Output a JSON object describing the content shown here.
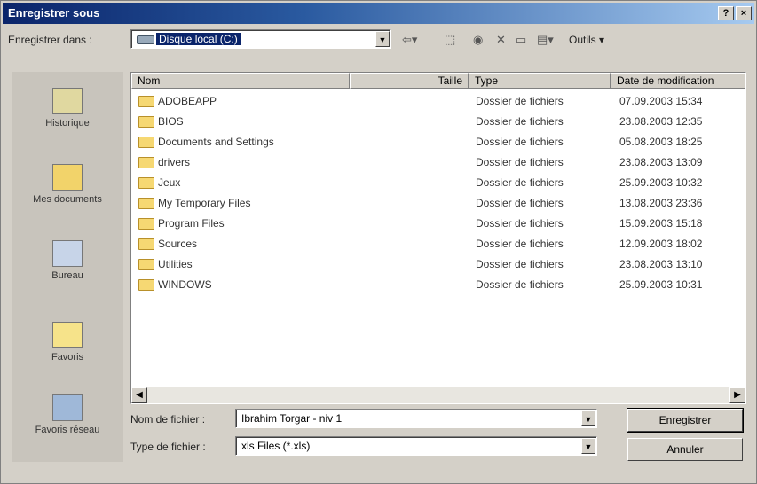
{
  "title": "Enregistrer sous",
  "title_buttons": [
    "?",
    "×"
  ],
  "save_in": {
    "label": "Enregistrer dans :",
    "value": "Disque local (C:)"
  },
  "toolbar": {
    "tools_label": "Outils ▾"
  },
  "places": [
    {
      "label": "Historique",
      "icon": "history-icon"
    },
    {
      "label": "Mes documents",
      "icon": "my-documents-icon"
    },
    {
      "label": "Bureau",
      "icon": "desktop-icon"
    },
    {
      "label": "Favoris",
      "icon": "favorites-icon"
    },
    {
      "label": "Favoris réseau",
      "icon": "network-places-icon"
    }
  ],
  "columns": [
    "Nom",
    "Taille",
    "Type",
    "Date de modification"
  ],
  "files": [
    {
      "name": "ADOBEAPP",
      "type": "Dossier de fichiers",
      "date": "07.09.2003 15:34"
    },
    {
      "name": "BIOS",
      "type": "Dossier de fichiers",
      "date": "23.08.2003 12:35"
    },
    {
      "name": "Documents and Settings",
      "type": "Dossier de fichiers",
      "date": "05.08.2003 18:25"
    },
    {
      "name": "drivers",
      "type": "Dossier de fichiers",
      "date": "23.08.2003 13:09"
    },
    {
      "name": "Jeux",
      "type": "Dossier de fichiers",
      "date": "25.09.2003 10:32"
    },
    {
      "name": "My Temporary Files",
      "type": "Dossier de fichiers",
      "date": "13.08.2003 23:36"
    },
    {
      "name": "Program Files",
      "type": "Dossier de fichiers",
      "date": "15.09.2003 15:18"
    },
    {
      "name": "Sources",
      "type": "Dossier de fichiers",
      "date": "12.09.2003 18:02"
    },
    {
      "name": "Utilities",
      "type": "Dossier de fichiers",
      "date": "23.08.2003 13:10"
    },
    {
      "name": "WINDOWS",
      "type": "Dossier de fichiers",
      "date": "25.09.2003 10:31"
    }
  ],
  "filename": {
    "label": "Nom de fichier :",
    "value": "Ibrahim Torgar - niv 1"
  },
  "filetype": {
    "label": "Type de fichier :",
    "value": "xls Files (*.xls)"
  },
  "buttons": {
    "save": "Enregistrer",
    "cancel": "Annuler"
  }
}
